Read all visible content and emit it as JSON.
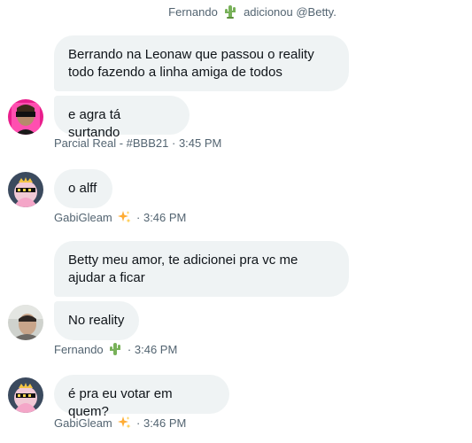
{
  "system": {
    "actor": "Fernando",
    "action": "adicionou @Betty."
  },
  "messages": [
    {
      "id": "m1",
      "text": "Berrando na Leonaw que passou o reality todo fazendo a linha amiga de todos"
    },
    {
      "id": "m2",
      "text": "e agra tá surtando"
    },
    {
      "id": "m3",
      "text": "o alff"
    },
    {
      "id": "m4",
      "text": "Betty meu amor, te adicionei pra vc me ajudar a ficar"
    },
    {
      "id": "m5",
      "text": "No reality"
    },
    {
      "id": "m6",
      "text": "é pra eu votar em quem?"
    }
  ],
  "meta": [
    {
      "sender": "Parcial Real - #BBB21",
      "separator": "·",
      "time": "3:45 PM",
      "emoji": ""
    },
    {
      "sender": "GabiGleam",
      "separator": "·",
      "time": "3:46 PM",
      "emoji": "sparkles-icon"
    },
    {
      "sender": "Fernando",
      "separator": "·",
      "time": "3:46 PM",
      "emoji": "cactus-icon"
    },
    {
      "sender": "GabiGleam",
      "separator": "·",
      "time": "3:46 PM",
      "emoji": "sparkles-icon"
    }
  ],
  "colors": {
    "bubble_bg": "#eff3f4",
    "meta_text": "#536471",
    "text": "#0f1419",
    "cactus": "#78b159",
    "sparkles": "#ffac33"
  }
}
